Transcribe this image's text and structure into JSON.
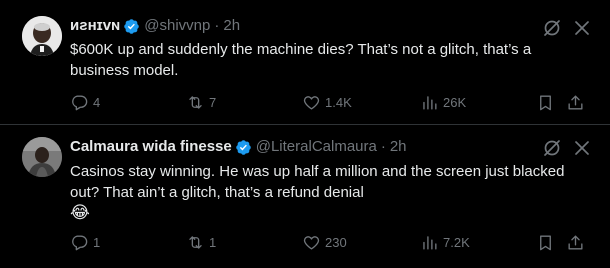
{
  "colors": {
    "background": "#000000",
    "text": "#e7e9ea",
    "muted": "#71767b",
    "verified": "#1d9bf0",
    "divider": "#2f3336"
  },
  "tweets": [
    {
      "name": "ᴎƨнɪvɴ",
      "verified_icon": "verified-badge-icon",
      "handle": "@shivvnp",
      "separator": "·",
      "time": "2h",
      "text": "$600K up and suddenly the machine dies? That’s not a glitch, that’s a business model.",
      "emoji": "",
      "replies": "4",
      "reposts": "7",
      "likes": "1.4K",
      "views": "26K"
    },
    {
      "name": "Calmaura wida finesse",
      "verified_icon": "verified-badge-icon",
      "handle": "@LiteralCalmaura",
      "separator": "·",
      "time": "2h",
      "text": "Casinos stay winning. He was up half a million and the screen just blacked out? That ain’t a glitch, that’s a refund denial",
      "emoji": "😂",
      "replies": "1",
      "reposts": "1",
      "likes": "230",
      "views": "7.2K"
    }
  ]
}
